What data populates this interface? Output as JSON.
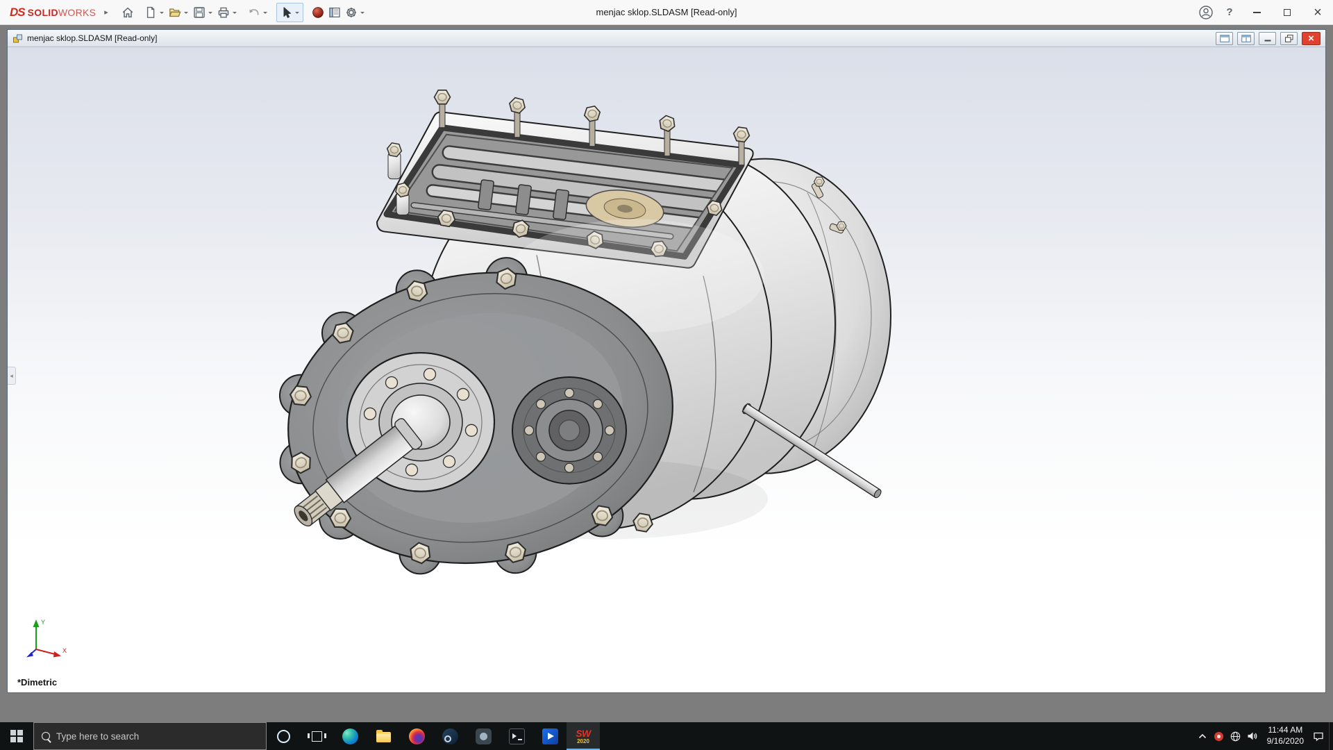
{
  "titlebar": {
    "brand": {
      "logo": "DS",
      "strong": "SOLID",
      "light": "WORKS"
    },
    "menu_expand_glyph": "▸",
    "title": "menjac sklop.SLDASM [Read-only]",
    "help_glyph": "?",
    "close_glyph": "×"
  },
  "toolbar": {
    "icon_names": [
      "home",
      "new-document",
      "open",
      "save",
      "print",
      "undo",
      "select-arrow",
      "red-sphere",
      "task-pane",
      "options-gear"
    ]
  },
  "doc": {
    "title": "menjac sklop.SLDASM [Read-only]",
    "close_glyph": "×",
    "view_label": "*Dimetric",
    "triad": {
      "x": "X",
      "y": "Y"
    }
  },
  "taskbar": {
    "search_placeholder": "Type here to search",
    "app_icons": [
      "cortana",
      "task-view",
      "edge",
      "file-explorer",
      "firefox",
      "steam",
      "app-dark",
      "terminal",
      "media-player",
      "solidworks-2020"
    ],
    "sw_icon_text": "SW",
    "sw_year": "2020",
    "tray_icons": [
      "hidden-icons-chevron",
      "status-red",
      "network-globe",
      "volume",
      "clock",
      "action-center"
    ],
    "tray": {
      "time": "11:44 AM",
      "date": "9/16/2020"
    }
  }
}
